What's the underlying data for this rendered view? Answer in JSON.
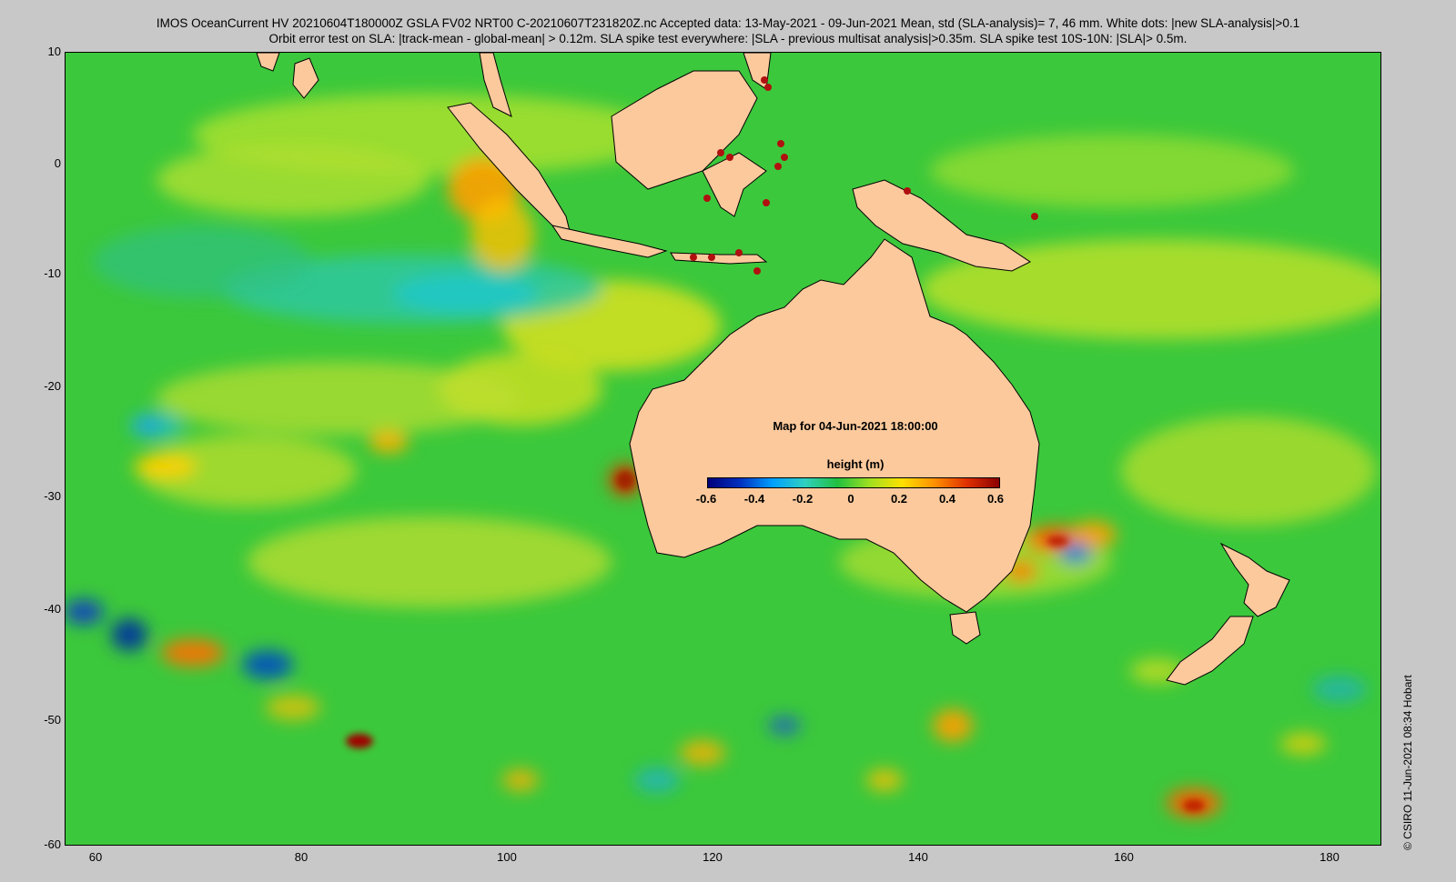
{
  "header": {
    "line1": "IMOS OceanCurrent HV 20210604T180000Z GSLA FV02 NRT00 C-20210607T231820Z.nc  Accepted data: 13-May-2021 - 09-Jun-2021 Mean, std (SLA-analysis)= 7, 46 mm. White dots: |new SLA-analysis|>0.1",
    "line2": "Orbit error test on SLA: |track-mean  - global-mean| > 0.12m.  SLA spike test everywhere: |SLA - previous multisat analysis|>0.35m. SLA spike test 10S-10N: |SLA|> 0.5m."
  },
  "map": {
    "date_label": "Map for 04-Jun-2021 18:00:00",
    "lon_range": [
      57,
      185
    ],
    "lat_range": [
      -60,
      10
    ],
    "lon_ticks": [
      "60",
      "80",
      "100",
      "120",
      "140",
      "160",
      "180"
    ],
    "lat_ticks": [
      "10",
      "0",
      "-10",
      "-20",
      "-30",
      "-40",
      "-50",
      "-60"
    ],
    "land_color": "#fbc99c",
    "ocean_base_color": "#3cc83c"
  },
  "colorbar": {
    "label": "height (m)",
    "ticks": [
      "-0.6",
      "-0.4",
      "-0.2",
      "0",
      "0.2",
      "0.4",
      "0.6"
    ],
    "range": [
      -0.6,
      0.6
    ]
  },
  "credit": "© CSIRO 11-Jun-2021 08:34 Hobart"
}
